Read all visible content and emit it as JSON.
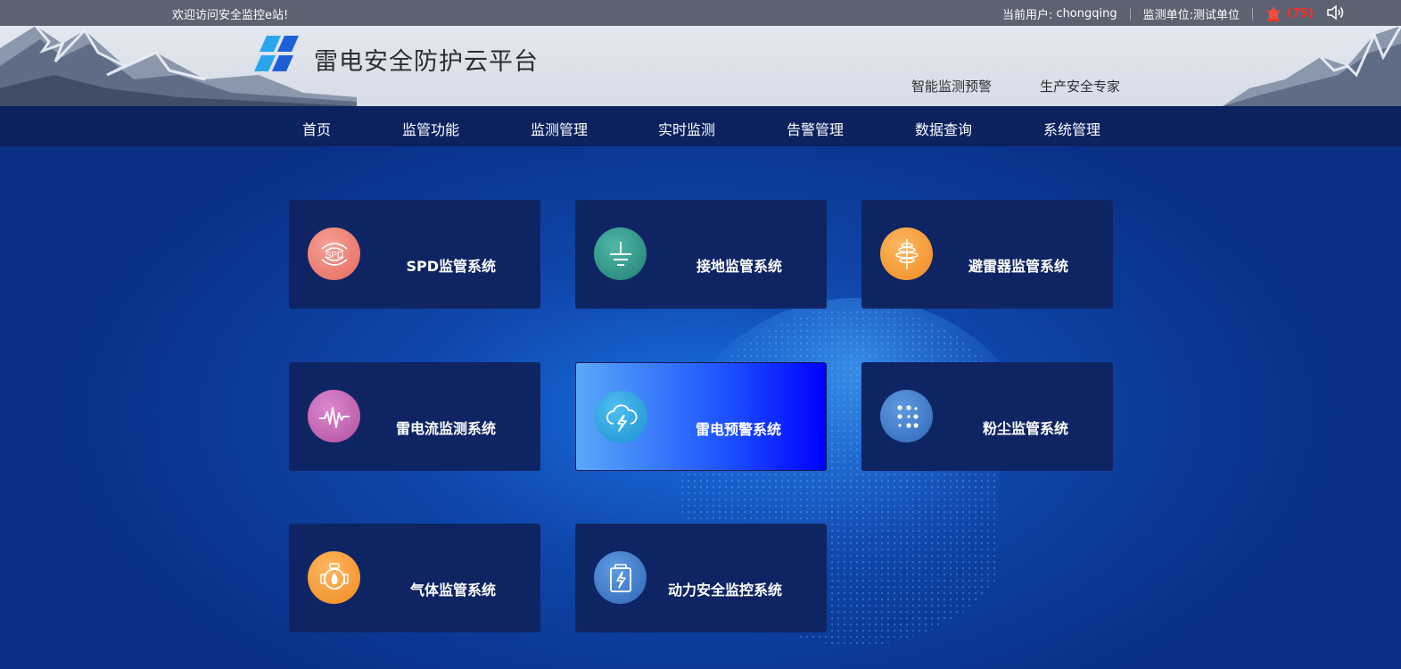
{
  "topbar": {
    "welcome": "欢迎访问安全监控e站!",
    "current_user_label": "当前用户:",
    "current_user": "chongqing",
    "unit_label": "监测单位:",
    "unit": "测试单位",
    "alarm_count": "(75)"
  },
  "header": {
    "title": "雷电安全防护云平台",
    "links": [
      "智能监测预警",
      "生产安全专家"
    ]
  },
  "nav": {
    "items": [
      "首页",
      "监管功能",
      "监测管理",
      "实时监测",
      "告警管理",
      "数据查询",
      "系统管理"
    ]
  },
  "cards": [
    {
      "label": "SPD监管系统",
      "icon": "spd-icon",
      "color": "#ef7a6e"
    },
    {
      "label": "接地监管系统",
      "icon": "ground-icon",
      "color": "#2d9a8c"
    },
    {
      "label": "避雷器监管系统",
      "icon": "arrester-icon",
      "color": "#f49a34"
    },
    {
      "label": "雷电流监测系统",
      "icon": "waveform-icon",
      "color": "#c564b8"
    },
    {
      "label": "雷电预警系统",
      "icon": "storm-cloud-icon",
      "color": "#2fa3e0",
      "active": true
    },
    {
      "label": "粉尘监管系统",
      "icon": "dots-icon",
      "color": "#3d7fcf"
    },
    {
      "label": "气体监管系统",
      "icon": "gas-icon",
      "color": "#f49a34"
    },
    {
      "label": "动力安全监控系统",
      "icon": "battery-icon",
      "color": "#3d7fcf"
    }
  ],
  "colors": {
    "topbar": "#5d6270",
    "nav": "#0b225f",
    "card": "#0f2563",
    "alarm": "#ff2b2b"
  }
}
